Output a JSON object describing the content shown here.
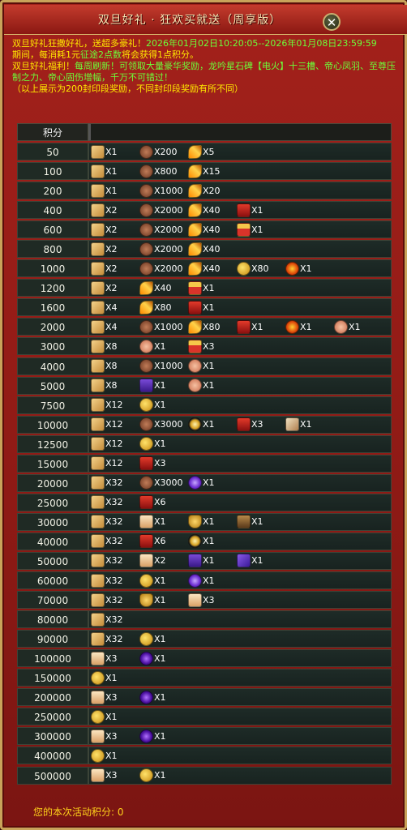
{
  "window": {
    "title": "双旦好礼 · 狂欢买就送（周享版）",
    "close_symbol": "✕"
  },
  "notice": {
    "line1_a": "双旦好礼狂撒好礼，送超多豪礼！",
    "line1_b": "2026年01月02日10:20:05--2026年01月08日23:59:59",
    "line2_a": "期间，每消耗1元",
    "line2_b": "征途2点数",
    "line2_c": "将会获得1点积分。",
    "line3_a": "双旦好礼福利！",
    "line3_b": "每周刷新！可领取大量豪华奖励，龙吟星石碑【电火】十三槽、帝心凤羽、至尊压制之力、帝心固伤增幅，千万不可错过！",
    "line4": "（以上展示为200封印段奖励，不同封印段奖励有所不同）"
  },
  "table": {
    "header": "积分",
    "rows": [
      {
        "points": "50",
        "items": [
          {
            "icon": "scroll",
            "qty": "X1"
          },
          {
            "icon": "meat",
            "qty": "X200"
          },
          {
            "icon": "feather",
            "qty": "X5"
          }
        ]
      },
      {
        "points": "100",
        "items": [
          {
            "icon": "scroll",
            "qty": "X1"
          },
          {
            "icon": "meat",
            "qty": "X800"
          },
          {
            "icon": "feather",
            "qty": "X15"
          }
        ]
      },
      {
        "points": "200",
        "items": [
          {
            "icon": "scroll",
            "qty": "X1"
          },
          {
            "icon": "meat",
            "qty": "X1000"
          },
          {
            "icon": "feather",
            "qty": "X20"
          }
        ]
      },
      {
        "points": "400",
        "items": [
          {
            "icon": "scroll",
            "qty": "X2"
          },
          {
            "icon": "meat",
            "qty": "X2000"
          },
          {
            "icon": "feather",
            "qty": "X40"
          },
          {
            "icon": "redbox",
            "qty": "X1"
          }
        ]
      },
      {
        "points": "600",
        "items": [
          {
            "icon": "scroll",
            "qty": "X2"
          },
          {
            "icon": "meat",
            "qty": "X2000"
          },
          {
            "icon": "feather",
            "qty": "X40"
          },
          {
            "icon": "giftbox",
            "qty": "X1"
          }
        ]
      },
      {
        "points": "800",
        "items": [
          {
            "icon": "scroll",
            "qty": "X2"
          },
          {
            "icon": "meat",
            "qty": "X2000"
          },
          {
            "icon": "feather",
            "qty": "X40"
          }
        ]
      },
      {
        "points": "1000",
        "items": [
          {
            "icon": "scroll",
            "qty": "X2"
          },
          {
            "icon": "meat",
            "qty": "X2000"
          },
          {
            "icon": "feather",
            "qty": "X40"
          },
          {
            "icon": "goldcoin",
            "qty": "X80"
          },
          {
            "icon": "flame",
            "qty": "X1"
          }
        ]
      },
      {
        "points": "1200",
        "items": [
          {
            "icon": "scroll",
            "qty": "X2"
          },
          {
            "icon": "feather",
            "qty": "X40"
          },
          {
            "icon": "giftbox",
            "qty": "X1"
          }
        ]
      },
      {
        "points": "1600",
        "items": [
          {
            "icon": "scroll",
            "qty": "X4"
          },
          {
            "icon": "feather",
            "qty": "X80"
          },
          {
            "icon": "redbox",
            "qty": "X1"
          }
        ]
      },
      {
        "points": "2000",
        "items": [
          {
            "icon": "scroll",
            "qty": "X4"
          },
          {
            "icon": "meat",
            "qty": "X1000"
          },
          {
            "icon": "feather",
            "qty": "X80"
          },
          {
            "icon": "redbox",
            "qty": "X1"
          },
          {
            "icon": "flame",
            "qty": "X1"
          },
          {
            "icon": "peach",
            "qty": "X1"
          }
        ]
      },
      {
        "points": "3000",
        "items": [
          {
            "icon": "scroll",
            "qty": "X8"
          },
          {
            "icon": "peach",
            "qty": "X1"
          },
          {
            "icon": "giftbox",
            "qty": "X3"
          }
        ]
      },
      {
        "points": "4000",
        "items": [
          {
            "icon": "scroll",
            "qty": "X8"
          },
          {
            "icon": "meat",
            "qty": "X1000"
          },
          {
            "icon": "peach",
            "qty": "X1"
          }
        ]
      },
      {
        "points": "5000",
        "items": [
          {
            "icon": "scroll",
            "qty": "X8"
          },
          {
            "icon": "purplebox",
            "qty": "X1"
          },
          {
            "icon": "peach",
            "qty": "X1"
          }
        ]
      },
      {
        "points": "7500",
        "items": [
          {
            "icon": "scroll",
            "qty": "X12"
          },
          {
            "icon": "goldcoin",
            "qty": "X1"
          }
        ]
      },
      {
        "points": "10000",
        "items": [
          {
            "icon": "scroll",
            "qty": "X12"
          },
          {
            "icon": "meat",
            "qty": "X3000"
          },
          {
            "icon": "starburst",
            "qty": "X1"
          },
          {
            "icon": "redbox",
            "qty": "X3"
          },
          {
            "icon": "stamp",
            "qty": "X1"
          }
        ]
      },
      {
        "points": "12500",
        "items": [
          {
            "icon": "scroll",
            "qty": "X12"
          },
          {
            "icon": "goldcoin",
            "qty": "X1"
          }
        ]
      },
      {
        "points": "15000",
        "items": [
          {
            "icon": "scroll",
            "qty": "X12"
          },
          {
            "icon": "redbox",
            "qty": "X3"
          }
        ]
      },
      {
        "points": "20000",
        "items": [
          {
            "icon": "scroll",
            "qty": "X32"
          },
          {
            "icon": "meat",
            "qty": "X3000"
          },
          {
            "icon": "purplegem",
            "qty": "X1"
          }
        ]
      },
      {
        "points": "25000",
        "items": [
          {
            "icon": "scroll",
            "qty": "X32"
          },
          {
            "icon": "redbox",
            "qty": "X6"
          }
        ]
      },
      {
        "points": "30000",
        "items": [
          {
            "icon": "scroll",
            "qty": "X32"
          },
          {
            "icon": "paperscroll",
            "qty": "X1"
          },
          {
            "icon": "goldshield",
            "qty": "X1"
          },
          {
            "icon": "portrait",
            "qty": "X1"
          }
        ]
      },
      {
        "points": "40000",
        "items": [
          {
            "icon": "scroll",
            "qty": "X32"
          },
          {
            "icon": "redbox",
            "qty": "X6"
          },
          {
            "icon": "starburst",
            "qty": "X1"
          }
        ]
      },
      {
        "points": "50000",
        "items": [
          {
            "icon": "scroll",
            "qty": "X32"
          },
          {
            "icon": "paperscroll",
            "qty": "X2"
          },
          {
            "icon": "purplebox",
            "qty": "X1"
          },
          {
            "icon": "purplerune",
            "qty": "X1"
          }
        ]
      },
      {
        "points": "60000",
        "items": [
          {
            "icon": "scroll",
            "qty": "X32"
          },
          {
            "icon": "goldcoin",
            "qty": "X1"
          },
          {
            "icon": "purplegem",
            "qty": "X1"
          }
        ]
      },
      {
        "points": "70000",
        "items": [
          {
            "icon": "scroll",
            "qty": "X32"
          },
          {
            "icon": "goldshield",
            "qty": "X1"
          },
          {
            "icon": "paperscroll",
            "qty": "X3"
          }
        ]
      },
      {
        "points": "80000",
        "items": [
          {
            "icon": "scroll",
            "qty": "X32"
          }
        ]
      },
      {
        "points": "90000",
        "items": [
          {
            "icon": "scroll",
            "qty": "X32"
          },
          {
            "icon": "goldcoin",
            "qty": "X1"
          }
        ]
      },
      {
        "points": "100000",
        "items": [
          {
            "icon": "paperscroll",
            "qty": "X3"
          },
          {
            "icon": "purpleorb",
            "qty": "X1"
          }
        ]
      },
      {
        "points": "150000",
        "items": [
          {
            "icon": "goldcoin",
            "qty": "X1"
          }
        ]
      },
      {
        "points": "200000",
        "items": [
          {
            "icon": "paperscroll",
            "qty": "X3"
          },
          {
            "icon": "purpleorb",
            "qty": "X1"
          }
        ]
      },
      {
        "points": "250000",
        "items": [
          {
            "icon": "goldcoin",
            "qty": "X1"
          }
        ]
      },
      {
        "points": "300000",
        "items": [
          {
            "icon": "paperscroll",
            "qty": "X3"
          },
          {
            "icon": "purpleorb",
            "qty": "X1"
          }
        ]
      },
      {
        "points": "400000",
        "items": [
          {
            "icon": "goldcoin",
            "qty": "X1"
          }
        ]
      },
      {
        "points": "500000",
        "items": [
          {
            "icon": "paperscroll",
            "qty": "X3"
          },
          {
            "icon": "goldcoin",
            "qty": "X1"
          }
        ]
      }
    ]
  },
  "footer": {
    "label": "您的本次活动积分:",
    "value": "0"
  }
}
